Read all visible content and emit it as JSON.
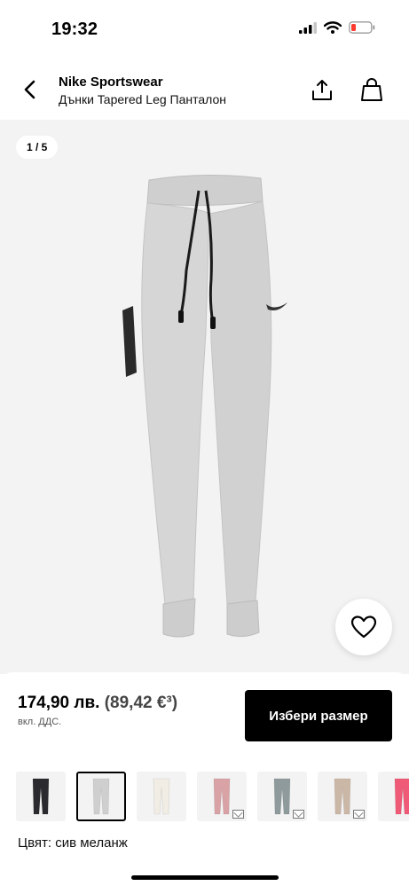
{
  "status_bar": {
    "time": "19:32",
    "icons": [
      "signal-icon",
      "wifi-icon",
      "battery-low-icon"
    ],
    "battery_color": "#ff3b30"
  },
  "header": {
    "brand": "Nike Sportswear",
    "product_name": "Дънки Tapered Leg Панталон",
    "icons": [
      "back-icon",
      "share-icon",
      "bag-icon"
    ]
  },
  "gallery": {
    "page_counter": "1 / 5",
    "image_alt": "grey melange tapered leg pants",
    "image_color": "#d3d3d3",
    "wishlist_icon": "heart-icon"
  },
  "purchase": {
    "price": "174,90 лв.",
    "price_alt": "(89,42 €³)",
    "vat_note": "вкл. ДДС.",
    "select_size_label": "Избери размер",
    "select_size_bg": "#000000"
  },
  "swatches": [
    {
      "name": "black",
      "color": "#2b2b2f",
      "selected": false,
      "notify": false
    },
    {
      "name": "grey",
      "color": "#cfcfcf",
      "selected": true,
      "notify": false
    },
    {
      "name": "white",
      "color": "#f1ede4",
      "selected": false,
      "notify": false
    },
    {
      "name": "pink",
      "color": "#d9a3a6",
      "selected": false,
      "notify": true
    },
    {
      "name": "slate",
      "color": "#8e9a9c",
      "selected": false,
      "notify": true
    },
    {
      "name": "beige",
      "color": "#cbb7a6",
      "selected": false,
      "notify": true
    },
    {
      "name": "hot-pink",
      "color": "#ef5a76",
      "selected": false,
      "notify": false
    }
  ],
  "color_label": "Цвят: сив меланж"
}
